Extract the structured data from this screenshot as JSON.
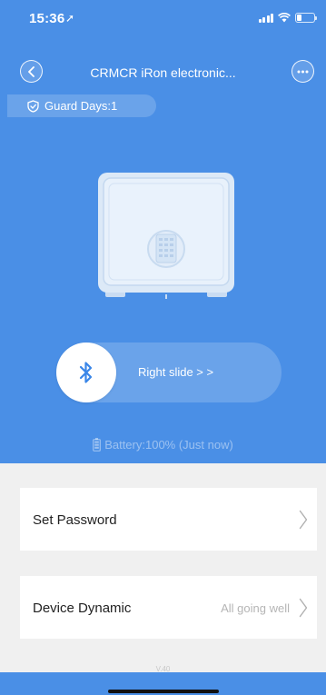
{
  "status_bar": {
    "time": "15:36"
  },
  "nav": {
    "title": "CRMCR iRon electronic..."
  },
  "guard": {
    "label": "Guard Days:1"
  },
  "slider": {
    "label": "Right slide > >"
  },
  "battery": {
    "label": "Battery:100% (Just now)"
  },
  "menu": [
    {
      "label": "Set Password",
      "value": ""
    },
    {
      "label": "Device Dynamic",
      "value": "All going well"
    }
  ],
  "footer": {
    "version": "V.40"
  },
  "colors": {
    "brand": "#4a8fe6",
    "background": "#f0f0f0"
  }
}
